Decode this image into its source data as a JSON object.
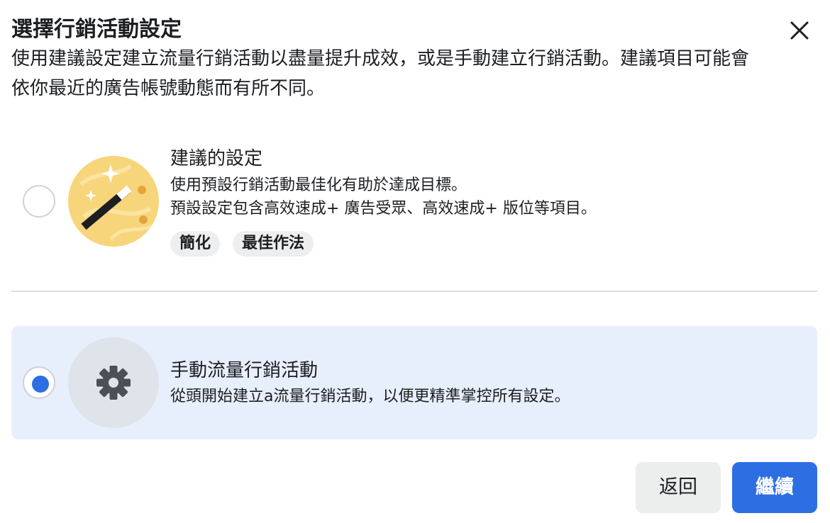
{
  "dialog": {
    "title": "選擇行銷活動設定",
    "description": "使用建議設定建立流量行銷活動以盡量提升成效，或是手動建立行銷活動。建議項目可能會依你最近的廣告帳號動態而有所不同。",
    "close_icon": "close-icon"
  },
  "options": [
    {
      "selected": false,
      "icon": "magic-wand-icon",
      "title": "建議的設定",
      "lines": [
        "使用預設行銷活動最佳化有助於達成目標。",
        "預設設定包含高效速成+ 廣告受眾、高效速成+ 版位等項目。"
      ],
      "tags": [
        "簡化",
        "最佳作法"
      ]
    },
    {
      "selected": true,
      "icon": "gear-icon",
      "title": "手動流量行銷活動",
      "lines": [
        "從頭開始建立a流量行銷活動，以便更精準掌控所有設定。"
      ]
    }
  ],
  "footer": {
    "back_label": "返回",
    "continue_label": "繼續"
  },
  "colors": {
    "primary": "#2d6fe3",
    "selected_card_bg": "#e8effc",
    "tag_bg": "#edeeef",
    "wand_circle": "#f7d57a"
  }
}
